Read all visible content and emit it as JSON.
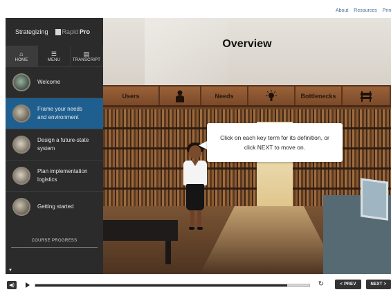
{
  "top_links": [
    "About",
    "Resources",
    "Print"
  ],
  "brand": {
    "strategizing": "Strategizing",
    "logo_light": "Rapid",
    "logo_bold": "Pro"
  },
  "nav_tabs": [
    {
      "icon": "home-icon",
      "label": "HOME"
    },
    {
      "icon": "menu-icon",
      "label": "MENU"
    },
    {
      "icon": "transcript-icon",
      "label": "TRANSCRIPT"
    }
  ],
  "menu_items": [
    {
      "label": "Welcome",
      "active": false
    },
    {
      "label": "Frame your needs and environment",
      "active": true
    },
    {
      "label": "Design a future-state system",
      "active": false
    },
    {
      "label": "Plan implementation logistics",
      "active": false
    },
    {
      "label": "Getting started",
      "active": false
    }
  ],
  "course_progress": {
    "label": "COURSE PROGRESS",
    "value": 0.05
  },
  "stage": {
    "title": "Overview",
    "terms": [
      {
        "label": "Users",
        "icon": ""
      },
      {
        "label": "",
        "icon": "person-icon"
      },
      {
        "label": "Needs",
        "icon": ""
      },
      {
        "label": "",
        "icon": "lightbulb-icon"
      },
      {
        "label": "Bottlenecks",
        "icon": ""
      },
      {
        "label": "",
        "icon": "barrier-icon"
      }
    ],
    "bubble_text": "Click on each key term for its definition, or click NEXT to move on."
  },
  "player": {
    "progress": 0.92,
    "prev_label": "< PREV",
    "next_label": "NEXT >"
  },
  "colors": {
    "sidebar": "#2b2b2b",
    "active_item": "#1f5f8f",
    "term_bar": "#7b4a2a"
  }
}
